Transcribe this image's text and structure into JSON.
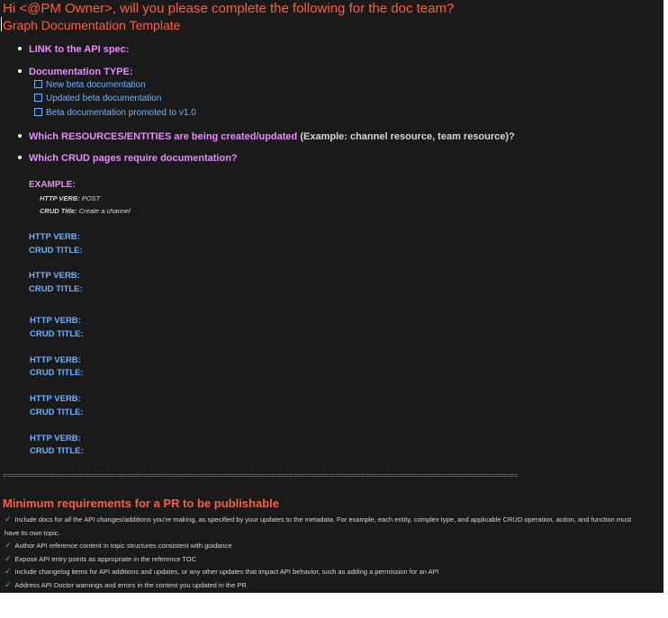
{
  "header": {
    "greeting": "Hi <@PM Owner>, will you please complete the following for the doc team?",
    "template_title": "Graph Documentation Template"
  },
  "bullets": {
    "api_spec": "LINK to the API spec:",
    "doc_type": "Documentation TYPE:",
    "resources": "Which RESOURCES/ENTITIES are being created/updated",
    "resources_example": "(Example: channel resource, team resource)?",
    "crud_pages": "Which CRUD pages require documentation?"
  },
  "doc_type_options": [
    "New beta documentation",
    "Updated beta documentation",
    "Beta documentation promoted to v1.0"
  ],
  "example": {
    "label": "EXAMPLE:",
    "verb_label": "HTTP VERB:",
    "verb_value": "POST",
    "title_label": "CRUD Title:",
    "title_value": "Create a channel"
  },
  "crud_labels": {
    "verb": "HTTP VERB:",
    "title": "CRUD TITLE:"
  },
  "divider": "================================================================================================================================",
  "requirements": {
    "title": "Minimum requirements for a PR to be publishable",
    "items": {
      "i0_pre": "Include docs for ",
      "i0_em": "all",
      "i0_post": " the API changes/additions you're making, as specified by your updates to the metadata. For example, each entity, complex type, and applicable CRUD operation, action, and function must have its own topic.",
      "i1": "Author API reference content in topic structures consistent with guidance",
      "i2": "Expose API entry points as appropriate in the reference TOC",
      "i3": "Include changelog items for API additions and updates, or any other updates that impact API behavior, such as adding a permission for an API",
      "i4": "Address API Doctor warnings and errors in the content you updated in the PR"
    }
  },
  "colors": {
    "background": "#1a1a1a",
    "heading_orange": "#ff5f38",
    "bullet_pink": "#e98aff",
    "link_blue": "#6eb3ff",
    "check_green": "#4ac26b"
  }
}
